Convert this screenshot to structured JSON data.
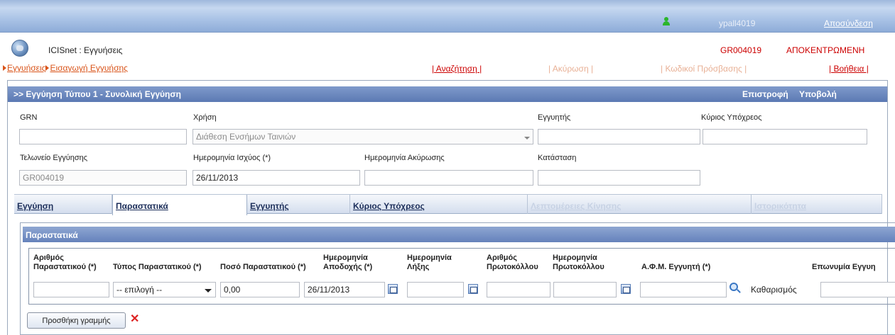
{
  "topbar": {
    "username": "ypall4019",
    "logout": "Αποσύνδεση"
  },
  "header": {
    "app_title": "ICISnet : Εγγυήσεις",
    "office_code": "GR004019",
    "mode": "ΑΠΟΚΕΝΤΡΩΜΕΝΗ",
    "breadcrumb": [
      "Εγγυήσεις",
      "Εισαγωγή Εγγυήσης"
    ],
    "nav": {
      "search": "| Αναζήτηση |",
      "cancel": "| Ακύρωση |",
      "passwords": "| Κωδικοί Πρόσβασης |",
      "help": "| Βοήθεια |"
    }
  },
  "panel": {
    "title": ">> Εγγύηση Τύπου 1 - Συνολική Εγγύηση",
    "back": "Επιστροφή",
    "submit": "Υποβολή"
  },
  "form": {
    "grn": {
      "label": "GRN",
      "value": ""
    },
    "usage": {
      "label": "Χρήση",
      "value": "Διάθεση Ενσήμων Ταινιών"
    },
    "guarantor": {
      "label": "Εγγυητής",
      "value": ""
    },
    "principal": {
      "label": "Κύριος Υπόχρεος",
      "value": ""
    },
    "office": {
      "label": "Τελωνείο Εγγύησης",
      "value": "GR004019"
    },
    "valid_date": {
      "label": "Ημερομηνία Ισχύος (*)",
      "value": "26/11/2013"
    },
    "cancel_date": {
      "label": "Ημερομηνία Ακύρωσης",
      "value": ""
    },
    "status": {
      "label": "Κατάσταση",
      "value": ""
    }
  },
  "tabs": [
    {
      "label": "Εγγύηση"
    },
    {
      "label": "Παραστατικά"
    },
    {
      "label": "Εγγυητής"
    },
    {
      "label": "Κύριος Υπόχρεος"
    },
    {
      "label": "Λεπτομέρειες Κίνησης"
    },
    {
      "label": "Ιστορικότητα"
    }
  ],
  "documents": {
    "title": "Παραστατικά",
    "columns": [
      {
        "line1": "Αριθμός",
        "line2": "Παραστατικού (*)"
      },
      {
        "line1": "",
        "line2": "Τύπος Παραστατικού (*)"
      },
      {
        "line1": "",
        "line2": "Ποσό Παραστατικού (*)"
      },
      {
        "line1": "Ημερομηνία",
        "line2": "Αποδοχής (*)"
      },
      {
        "line1": "Ημερομηνία",
        "line2": "Λήξης"
      },
      {
        "line1": "Αριθμός",
        "line2": "Πρωτοκόλλου"
      },
      {
        "line1": "Ημερομηνία",
        "line2": "Πρωτοκόλλου"
      },
      {
        "line1": "",
        "line2": "Α.Φ.Μ. Εγγυητή (*)"
      },
      {
        "line1": "",
        "line2": "Επωνυμία Εγγυη"
      }
    ],
    "row": {
      "doc_number": "",
      "doc_type": "-- επιλογή --",
      "amount": "0,00",
      "accept_date": "26/11/2013",
      "expiry_date": "",
      "protocol_number": "",
      "protocol_date": "",
      "guarantor_afm": "",
      "guarantor_name": ""
    },
    "clear": "Καθαρισμός",
    "add_row": "Προσθήκη γραμμής",
    "delete_symbol": "✕"
  },
  "colors": {
    "accent": "#5b79b3",
    "link": "#c00",
    "breadcrumb": "#d9541a"
  },
  "icons": [
    "user-icon",
    "globe-icon",
    "calendar-icon",
    "search-icon",
    "delete-icon"
  ]
}
